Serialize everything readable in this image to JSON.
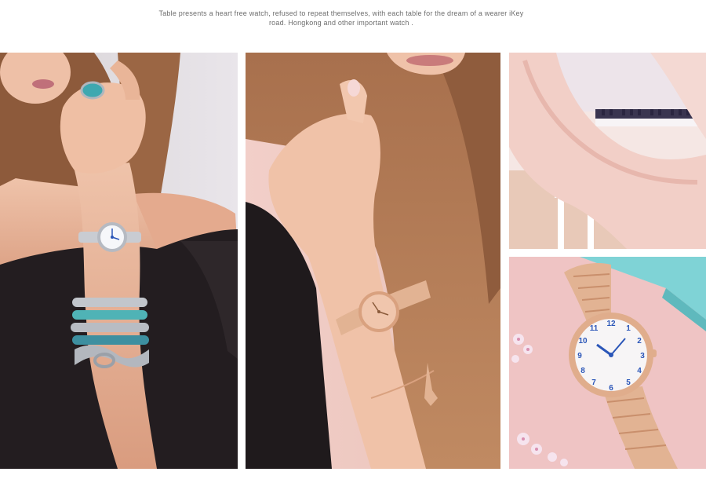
{
  "caption": {
    "line1": "Table  presents a heart free watch, refused to repeat themselves, with each table for the dream of a wearer iKey",
    "line2": "road. Hongkong and other important watch ."
  },
  "photos": {
    "left": {
      "subject": "woman-wearing-silver-watch-and-turquoise-bracelets"
    },
    "center": {
      "subject": "woman-wearing-rose-gold-watch-and-charm-bracelet"
    },
    "top_right": {
      "subject": "pink-fabric-draped-over-white-piano"
    },
    "bottom_right": {
      "subject": "rose-gold-watch-on-pink-surface-with-flowers"
    }
  },
  "colors": {
    "skin": "#e8b49a",
    "hair": "#8a5a3a",
    "top_black": "#1f1a1c",
    "silver": "#c9ccd2",
    "turquoise": "#4fb3b6",
    "rose_gold": "#e2b393",
    "blush_pink": "#f3d6cf",
    "tiffany_blue": "#7fd3d6",
    "dial_blue": "#2b56b8"
  }
}
